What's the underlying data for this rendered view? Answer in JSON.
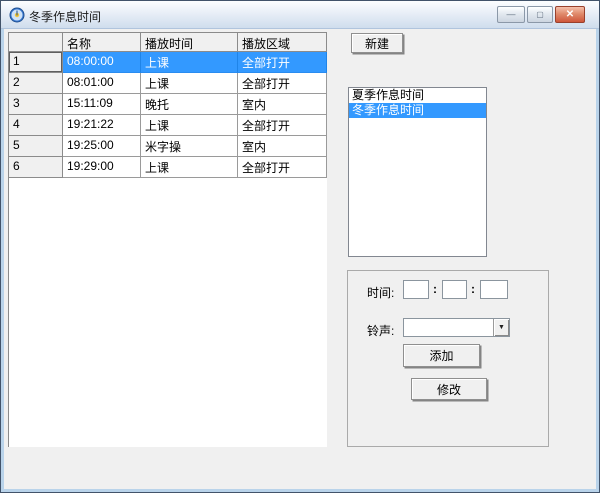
{
  "window": {
    "title": "冬季作息时间",
    "minimize_glyph": "—",
    "maximize_glyph": "▢",
    "close_glyph": "✕"
  },
  "toolbar": {
    "new_label": "新建"
  },
  "table": {
    "headers": [
      "",
      "名称",
      "播放时间",
      "播放区域"
    ],
    "selected_row_index": 0,
    "rows": [
      {
        "num": "1",
        "name": "08:00:00",
        "play_time": "上课",
        "play_area": "全部打开"
      },
      {
        "num": "2",
        "name": "08:01:00",
        "play_time": "上课",
        "play_area": "全部打开"
      },
      {
        "num": "3",
        "name": "15:11:09",
        "play_time": "晚托",
        "play_area": "室内"
      },
      {
        "num": "4",
        "name": "19:21:22",
        "play_time": "上课",
        "play_area": "全部打开"
      },
      {
        "num": "5",
        "name": "19:25:00",
        "play_time": "米字操",
        "play_area": "室内"
      },
      {
        "num": "6",
        "name": "19:29:00",
        "play_time": "上课",
        "play_area": "全部打开"
      }
    ]
  },
  "schedule_list": {
    "selected_index": 1,
    "items": [
      {
        "label": "夏季作息时间"
      },
      {
        "label": "冬季作息时间"
      }
    ]
  },
  "editor": {
    "time_label": "时间:",
    "colon": ":",
    "hour_value": "",
    "minute_value": "",
    "second_value": "",
    "ring_label": "铃声:",
    "ring_value": "",
    "dropdown_glyph": "▼",
    "add_label": "添加",
    "modify_label": "修改"
  },
  "colors": {
    "selection_bg": "#3399ff",
    "selection_text": "#ffffff",
    "close_button": "#cf563a",
    "client_bg": "#f0f0f0"
  }
}
